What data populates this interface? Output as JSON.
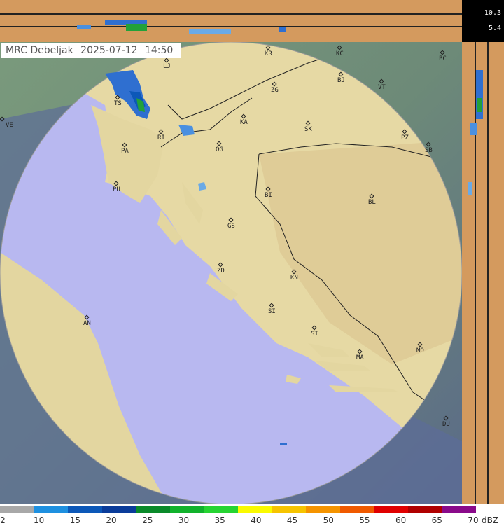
{
  "title": {
    "station": "MRC Debeljak",
    "date": "2025-07-12",
    "time": "14:50"
  },
  "height_labels": [
    "10.3",
    "5.4"
  ],
  "cities": [
    {
      "code": "KR"
    },
    {
      "code": "KC"
    },
    {
      "code": "PC"
    },
    {
      "code": "LJ"
    },
    {
      "code": "BJ"
    },
    {
      "code": "VT"
    },
    {
      "code": "ZG"
    },
    {
      "code": "TS"
    },
    {
      "code": "VE"
    },
    {
      "code": "KA"
    },
    {
      "code": "SK"
    },
    {
      "code": "PZ"
    },
    {
      "code": "SB"
    },
    {
      "code": "RI"
    },
    {
      "code": "PA"
    },
    {
      "code": "OG"
    },
    {
      "code": "PU"
    },
    {
      "code": "BI"
    },
    {
      "code": "BL"
    },
    {
      "code": "GS"
    },
    {
      "code": "ZD"
    },
    {
      "code": "KN"
    },
    {
      "code": "SI"
    },
    {
      "code": "AN"
    },
    {
      "code": "ST"
    },
    {
      "code": "MA"
    },
    {
      "code": "MO"
    },
    {
      "code": "DU"
    }
  ],
  "scale": {
    "unit": "dBZ",
    "labels": [
      "2",
      "10",
      "15",
      "20",
      "25",
      "30",
      "35",
      "40",
      "45",
      "50",
      "55",
      "60",
      "65",
      "70"
    ],
    "colors": [
      "#a8a8a8",
      "#1e90e0",
      "#0c58b8",
      "#0a3c9a",
      "#0a8a2a",
      "#11b22c",
      "#26d432",
      "#fafa00",
      "#f6c400",
      "#f59400",
      "#f05a00",
      "#e00000",
      "#b00000",
      "#8a0a8a"
    ]
  },
  "colors": {
    "land": "#e3d6a0",
    "sea": "#b8b8f0",
    "outside": "#6f8a7a",
    "strip": "#d49a5e"
  }
}
